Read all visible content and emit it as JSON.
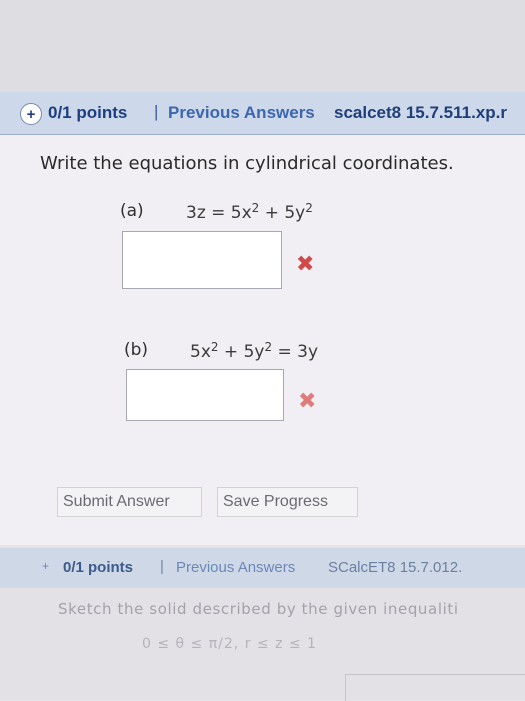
{
  "question": {
    "points": "0/1 points",
    "separator": "|",
    "previous_answers": "Previous Answers",
    "problem_id": "scalcet8 15.7.511.xp.r",
    "prompt": "Write the equations in cylindrical coordinates.",
    "parts": [
      {
        "label": "(a)",
        "lhs": "3z = 5x",
        "exp1": "2",
        "mid": " + 5y",
        "exp2": "2",
        "tail": "",
        "answer": "",
        "status_icon": "wrong-x-icon"
      },
      {
        "label": "(b)",
        "lhs": "5x",
        "exp1": "2",
        "mid": " + 5y",
        "exp2": "2",
        "tail": " = 3y",
        "answer": "",
        "status_icon": "wrong-x-icon"
      }
    ],
    "submit_label": "Submit Answer",
    "save_label": "Save Progress"
  },
  "next_question": {
    "points": "0/1 points",
    "separator": "|",
    "previous_answers": "Previous Answers",
    "problem_id": "SCalcET8 15.7.012.",
    "prompt": "Sketch the solid described by the given inequaliti",
    "inequality": "0 ≤ θ ≤ π/2, r ≤ z ≤ 1"
  },
  "colors": {
    "header_bg": "#cdd8ea",
    "link_blue": "#3d66ad",
    "error_red": "#d14a4a"
  }
}
